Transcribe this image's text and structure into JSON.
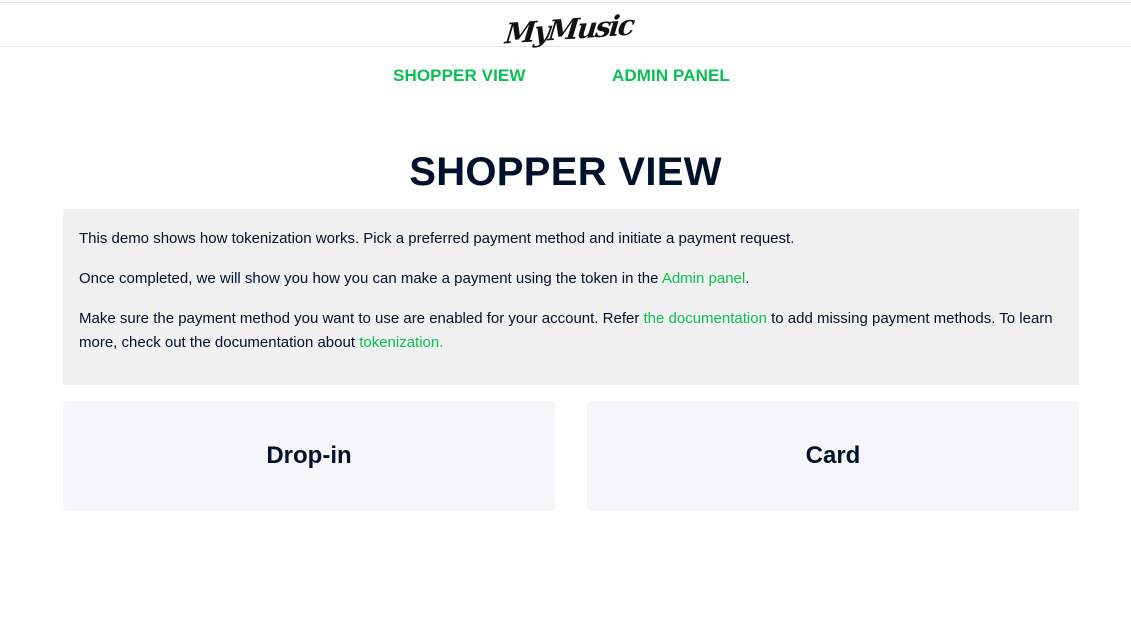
{
  "header": {
    "logo_text": "MyMusic"
  },
  "nav": {
    "shopper_view": "SHOPPER VIEW",
    "admin_panel": "ADMIN PANEL"
  },
  "main": {
    "title": "SHOPPER VIEW",
    "info": {
      "p1": "This demo shows how tokenization works. Pick a preferred payment method and initiate a payment request.",
      "p2_before": "Once completed, we will show you how you can make a payment using the token in the ",
      "p2_link": "Admin panel",
      "p2_after": ".",
      "p3_before": "Make sure the payment method you want to use are enabled for your account. Refer ",
      "p3_link1": "the documentation",
      "p3_mid": " to add missing payment methods. To learn more, check out the documentation about ",
      "p3_link2": "tokenization."
    },
    "options": [
      {
        "label": "Drop-in"
      },
      {
        "label": "Card"
      }
    ]
  },
  "colors": {
    "accent": "#0abf53",
    "text": "#00112c",
    "info_bg": "#f0f0f0",
    "card_bg": "#f5f6f8"
  }
}
